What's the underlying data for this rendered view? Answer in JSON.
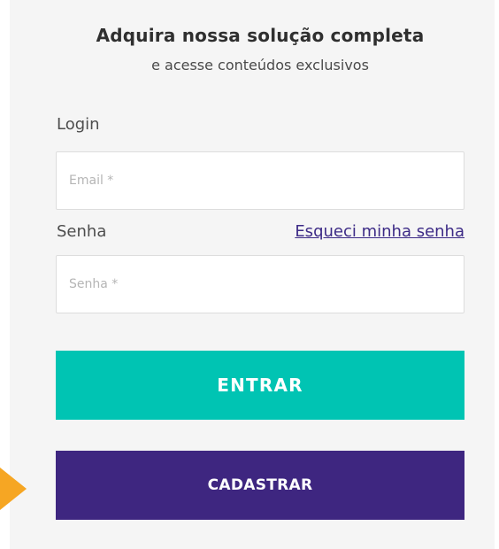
{
  "promo": {
    "headline": "Adquira nossa solução completa",
    "subheadline": "e acesse conteúdos exclusivos"
  },
  "login_form": {
    "login_label": "Login",
    "email_placeholder": "Email *",
    "password_label": "Senha",
    "forgot_password_link": "Esqueci minha senha",
    "password_placeholder": "Senha *",
    "enter_button": "ENTRAR",
    "register_button": "CADASTRAR"
  },
  "colors": {
    "enter_button": "#00c4b3",
    "register_button": "#3e2680",
    "link": "#3c2a86",
    "pointer_arrow": "#f6a623",
    "panel_background": "#f5f5f5"
  },
  "decorations": {
    "pointer_icon": "orange-arrow-icon"
  }
}
